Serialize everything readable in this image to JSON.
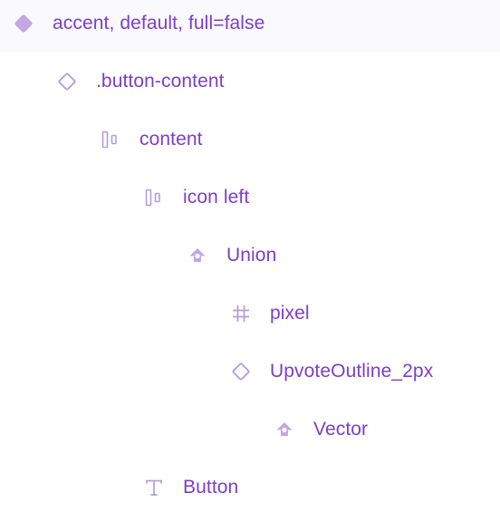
{
  "layers_panel": {
    "accent_color": "#7b3fc8",
    "icon_color": "#b39ddb",
    "items": [
      {
        "label": "accent, default, full=false",
        "icon": "component-set-icon"
      },
      {
        "label": ".button-content",
        "icon": "instance-icon"
      },
      {
        "label": "content",
        "icon": "auto-layout-horizontal-icon"
      },
      {
        "label": "icon left",
        "icon": "auto-layout-horizontal-icon"
      },
      {
        "label": "Union",
        "icon": "boolean-union-icon"
      },
      {
        "label": "pixel",
        "icon": "frame-icon"
      },
      {
        "label": "UpvoteOutline_2px",
        "icon": "instance-icon"
      },
      {
        "label": "Vector",
        "icon": "boolean-union-icon"
      },
      {
        "label": "Button",
        "icon": "text-icon"
      }
    ]
  }
}
